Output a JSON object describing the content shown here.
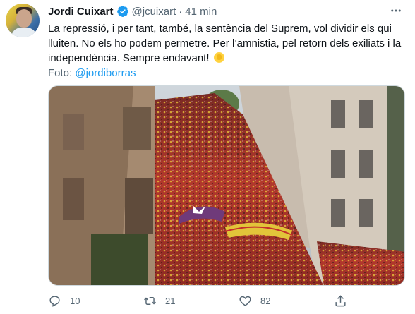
{
  "tweet": {
    "author_name": "Jordi Cuixart",
    "author_handle": "@jcuixart",
    "separator": "·",
    "time": "41 min",
    "text_line1": "La repressió, i per tant, també, la sentència del Suprem, vol dividir els qui",
    "text_line2": "lluiten. No els ho podem permetre. Per l’amnistia, pel retorn dels exiliats i la",
    "text_line3": "independència. Sempre endavant!",
    "photo_label": "Foto:",
    "photo_mention": "@jordiborras"
  },
  "actions": {
    "reply_count": "10",
    "retweet_count": "21",
    "like_count": "82"
  },
  "icons": {
    "verified": "verified-badge-icon",
    "more": "more-icon",
    "reply": "reply-icon",
    "retweet": "retweet-icon",
    "like": "heart-icon",
    "share": "share-icon",
    "emoji": "raised-fist-emoji"
  },
  "colors": {
    "text": "#0f1419",
    "secondary": "#536471",
    "link": "#1d9bf0"
  }
}
